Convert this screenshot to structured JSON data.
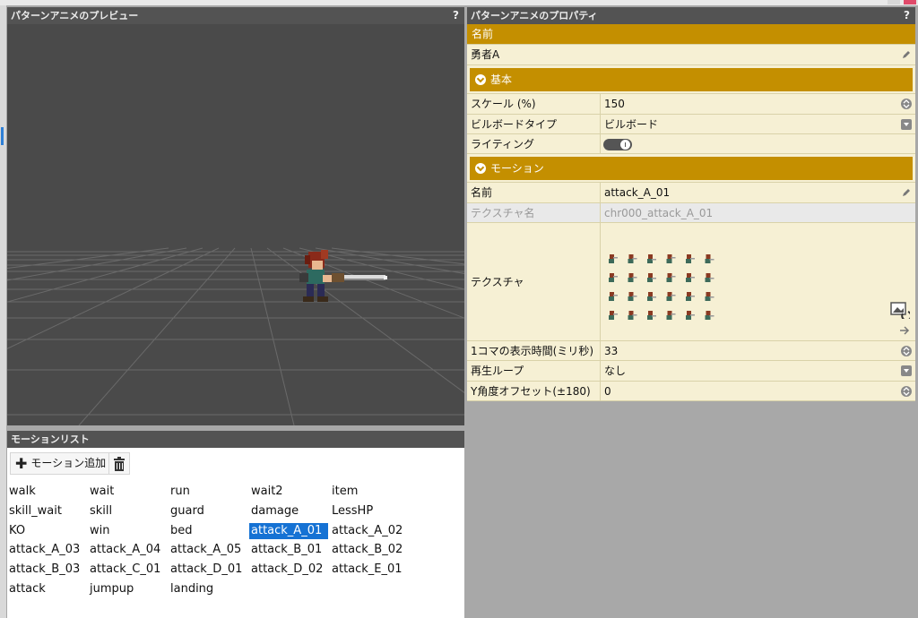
{
  "preview": {
    "title": "パターンアニメのプレビュー",
    "help": "?"
  },
  "motion_list": {
    "title": "モーションリスト",
    "add_label": "モーション追加",
    "items": [
      "walk",
      "wait",
      "run",
      "wait2",
      "item",
      "skill_wait",
      "skill",
      "guard",
      "damage",
      "LessHP",
      "KO",
      "win",
      "bed",
      "attack_A_01",
      "attack_A_02",
      "attack_A_03",
      "attack_A_04",
      "attack_A_05",
      "attack_B_01",
      "attack_B_02",
      "attack_B_03",
      "attack_C_01",
      "attack_D_01",
      "attack_D_02",
      "attack_E_01",
      "attack",
      "jumpup",
      "landing"
    ],
    "selected": "attack_A_01"
  },
  "properties": {
    "title": "パターンアニメのプロパティ",
    "help": "?",
    "name_header": "名前",
    "name_value": "勇者A",
    "basic_section": "基本",
    "scale_label": "スケール (%)",
    "scale_value": "150",
    "billboard_label": "ビルボードタイプ",
    "billboard_value": "ビルボード",
    "lighting_label": "ライティング",
    "motion_section": "モーション",
    "motion_name_label": "名前",
    "motion_name_value": "attack_A_01",
    "texture_name_label": "テクスチャ名",
    "texture_name_value": "chr000_attack_A_01",
    "texture_label": "テクスチャ",
    "frame_time_label": "1コマの表示時間(ミリ秒)",
    "frame_time_value": "33",
    "loop_label": "再生ループ",
    "loop_value": "なし",
    "yoffset_label": "Y角度オフセット(±180)",
    "yoffset_value": "0"
  },
  "colors": {
    "accent": "#c48f00",
    "selection": "#1572d4",
    "panel_bg": "#f6f0d4"
  }
}
